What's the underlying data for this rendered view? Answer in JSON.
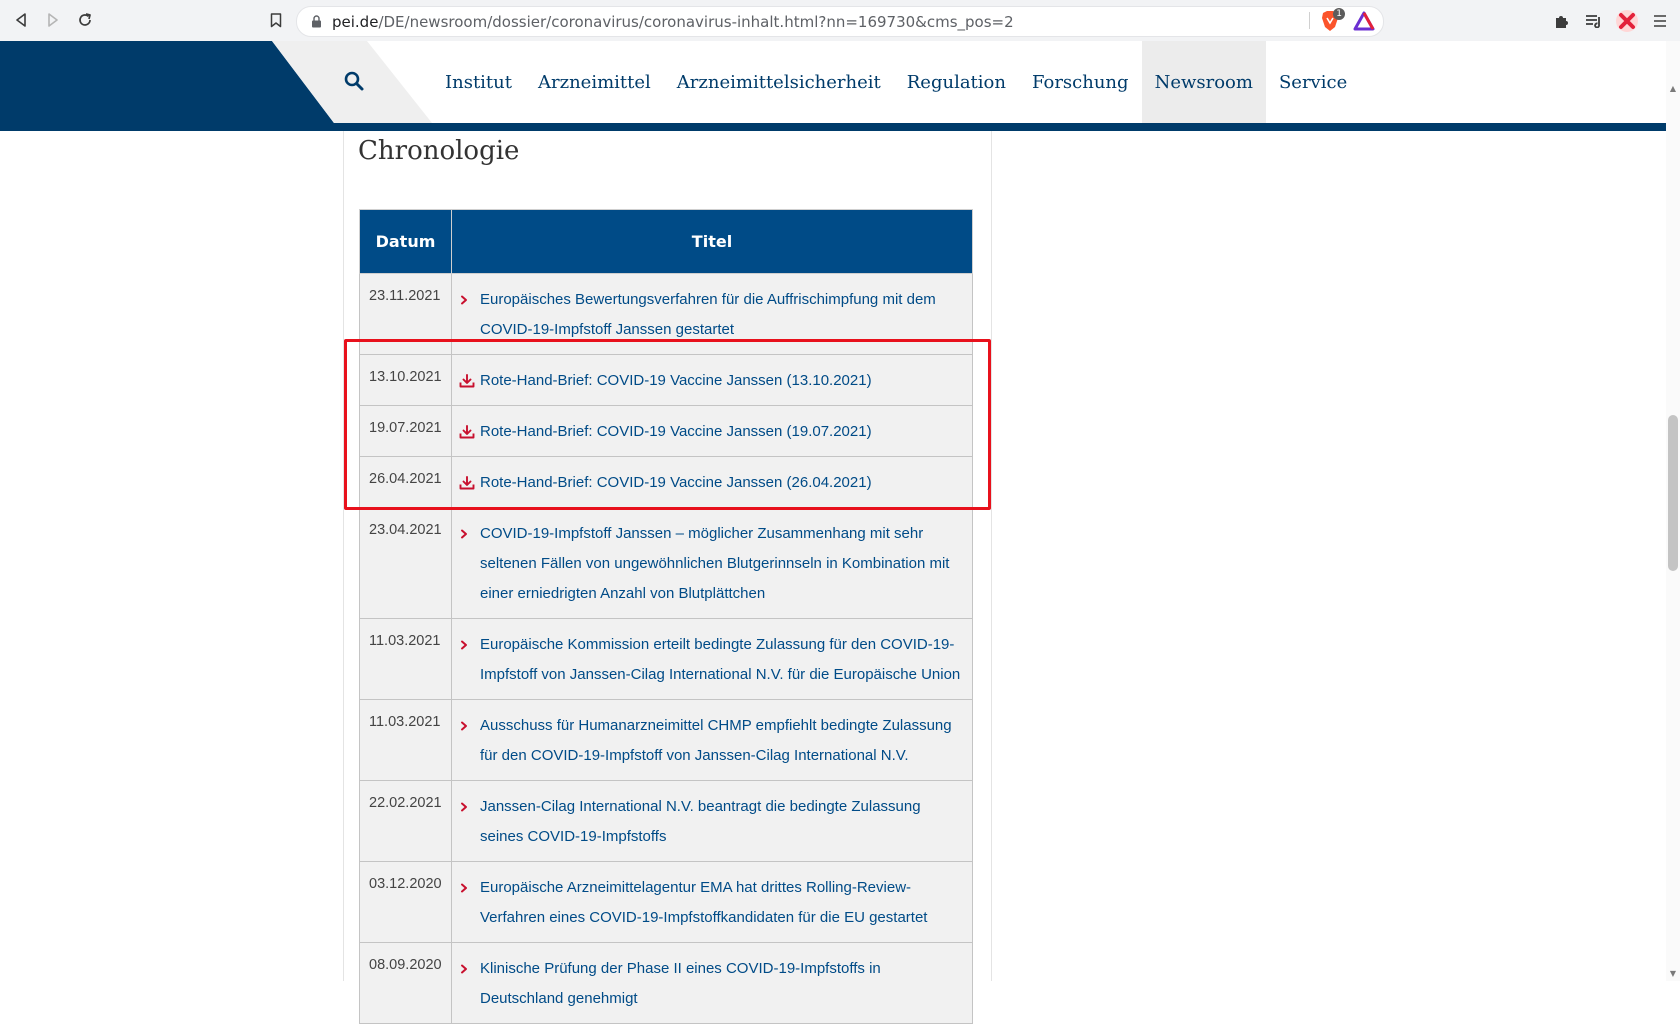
{
  "browser": {
    "url_host": "pei.de",
    "url_path": "/DE/newsroom/dossier/coronavirus/coronavirus-inhalt.html?nn=169730&cms_pos=2",
    "brave_badge": "1"
  },
  "nav": {
    "items": [
      "Institut",
      "Arzneimittel",
      "Arzneimittelsicherheit",
      "Regulation",
      "Forschung",
      "Newsroom",
      "Service"
    ],
    "active": "Newsroom"
  },
  "page": {
    "title": "Chronologie"
  },
  "table": {
    "headers": [
      "Datum",
      "Titel"
    ],
    "rows": [
      {
        "date": "23.11.2021",
        "type": "link",
        "title": "Europäisches Bewertungsverfahren für die Auffrischimpfung mit dem COVID-19-Impfstoff Janssen gestartet"
      },
      {
        "date": "13.10.2021",
        "type": "download",
        "title": "Rote-Hand-Brief: COVID-19 Vaccine Janssen (13.10.2021)"
      },
      {
        "date": "19.07.2021",
        "type": "download",
        "title": "Rote-Hand-Brief: COVID-19 Vaccine Janssen (19.07.2021)"
      },
      {
        "date": "26.04.2021",
        "type": "download",
        "title": "Rote-Hand-Brief: COVID-19 Vaccine Janssen (26.04.2021)"
      },
      {
        "date": "23.04.2021",
        "type": "link",
        "title": "COVID-19-Impfstoff Janssen – möglicher Zusammenhang mit sehr seltenen Fällen von ungewöhnlichen Blutgerinnseln in Kombination mit einer erniedrigten Anzahl von Blutplättchen"
      },
      {
        "date": "11.03.2021",
        "type": "link",
        "title": "Europäische Kommission erteilt bedingte Zulassung für den COVID-19-Impfstoff von Janssen-Cilag International N.V. für die Europäische Union"
      },
      {
        "date": "11.03.2021",
        "type": "link",
        "title": "Ausschuss für Humanarzneimittel CHMP empfiehlt bedingte Zulassung für den COVID-19-Impfstoff von Janssen-Cilag International N.V."
      },
      {
        "date": "22.02.2021",
        "type": "link",
        "title": "Janssen-Cilag International N.V. beantragt die bedingte Zulassung seines COVID-19-Impfstoffs"
      },
      {
        "date": "03.12.2020",
        "type": "link",
        "title": "Europäische Arzneimittelagentur EMA hat drittes Rolling-Review-Verfahren eines COVID-19-Impfstoffkandidaten für die EU gestartet"
      },
      {
        "date": "08.09.2020",
        "type": "link",
        "title": "Klinische Prüfung der Phase II eines COVID-19-Impfstoffs in Deutschland genehmigt"
      }
    ]
  },
  "colors": {
    "brand_navy": "#003b6a",
    "table_header": "#004b87",
    "link": "#004b87",
    "icon_red": "#c8102e",
    "highlight": "#e8111c"
  },
  "icons": {
    "link_row": "chevron-right-icon",
    "download_row": "download-icon"
  }
}
